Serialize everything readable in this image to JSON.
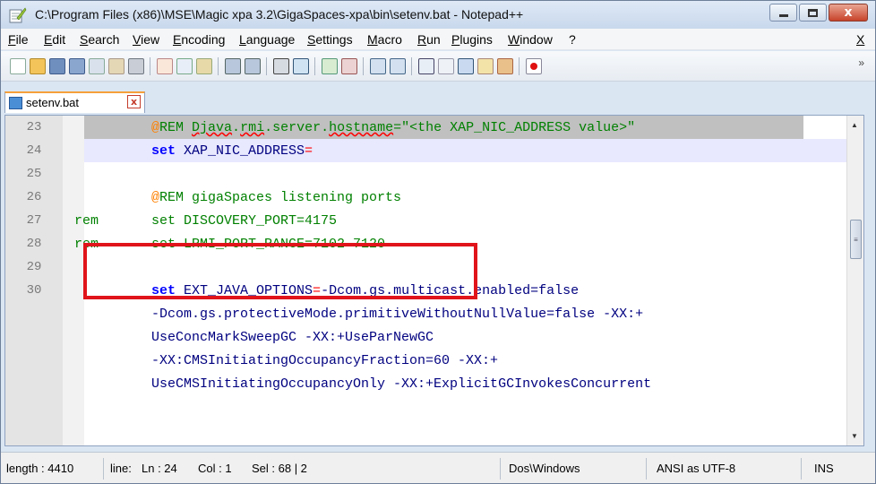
{
  "window": {
    "title": "C:\\Program Files (x86)\\MSE\\Magic xpa 3.2\\GigaSpaces-xpa\\bin\\setenv.bat - Notepad++",
    "close_glyph": "x"
  },
  "menu": {
    "items": [
      "File",
      "Edit",
      "Search",
      "View",
      "Encoding",
      "Language",
      "Settings",
      "Macro",
      "Run",
      "Plugins",
      "Window",
      "?"
    ],
    "close_doc": "X"
  },
  "toolbar": {
    "icons": [
      "new-file-icon",
      "open-file-icon",
      "save-icon",
      "save-all-icon",
      "close-icon",
      "close-all-icon",
      "print-icon",
      "cut-icon",
      "copy-icon",
      "paste-icon",
      "undo-icon",
      "redo-icon",
      "find-icon",
      "replace-icon",
      "zoom-in-icon",
      "zoom-out-icon",
      "sync-vertical-icon",
      "sync-horizontal-icon",
      "word-wrap-icon",
      "show-all-chars-icon",
      "indent-guide-icon",
      "doc-map-icon",
      "function-list-icon",
      "record-macro-icon"
    ],
    "more": "»"
  },
  "tab": {
    "label": "setenv.bat",
    "close_glyph": "x"
  },
  "editor": {
    "lines": [
      {
        "num": "23",
        "at": "@",
        "rem": "REM ",
        "squig1": "Djava",
        "dot1": ".",
        "squig2": "rmi",
        "mid": ".server.",
        "squig3": "hostname",
        "rest": "=\"<the XAP_NIC_ADDRESS value>\""
      },
      {
        "num": "24",
        "kw": "set",
        "text": " XAP_NIC_ADDRESS",
        "op": "="
      },
      {
        "num": "25"
      },
      {
        "num": "26",
        "at": "@",
        "text": "REM gigaSpaces listening ports"
      },
      {
        "num": "27",
        "prefix": "rem",
        "kw": "set",
        "text": " DISCOVERY_PORT=4175"
      },
      {
        "num": "28",
        "prefix": "rem",
        "kw": "set",
        "text": " LRMI_PORT_RANGE=7102-7120"
      },
      {
        "num": "29"
      },
      {
        "num": "30",
        "kw": "set",
        "text": " EXT_JAVA_OPTIONS",
        "op": "=",
        "rest": "-Dcom.gs.multicast.enabled=false"
      },
      {
        "num": "",
        "text": "-Dcom.gs.protectiveMode.primitiveWithoutNullValue=false -XX:+"
      },
      {
        "num": "",
        "text": "UseConcMarkSweepGC -XX:+UseParNewGC"
      },
      {
        "num": "",
        "text": "-XX:CMSInitiatingOccupancyFraction=60 -XX:+"
      },
      {
        "num": "",
        "text": "UseCMSInitiatingOccupancyOnly -XX:+ExplicitGCInvokesConcurrent"
      }
    ]
  },
  "status": {
    "length": "length : 4410",
    "lines": "line:",
    "ln": "Ln : 24",
    "col": "Col : 1",
    "sel": "Sel : 68 | 2",
    "eol": "Dos\\Windows",
    "encoding": "ANSI as UTF-8",
    "mode": "INS"
  },
  "colors": {
    "comment": "#008000",
    "keyword": "#0000ff",
    "operator": "#ff0000",
    "highlight_box": "#e0141a"
  }
}
